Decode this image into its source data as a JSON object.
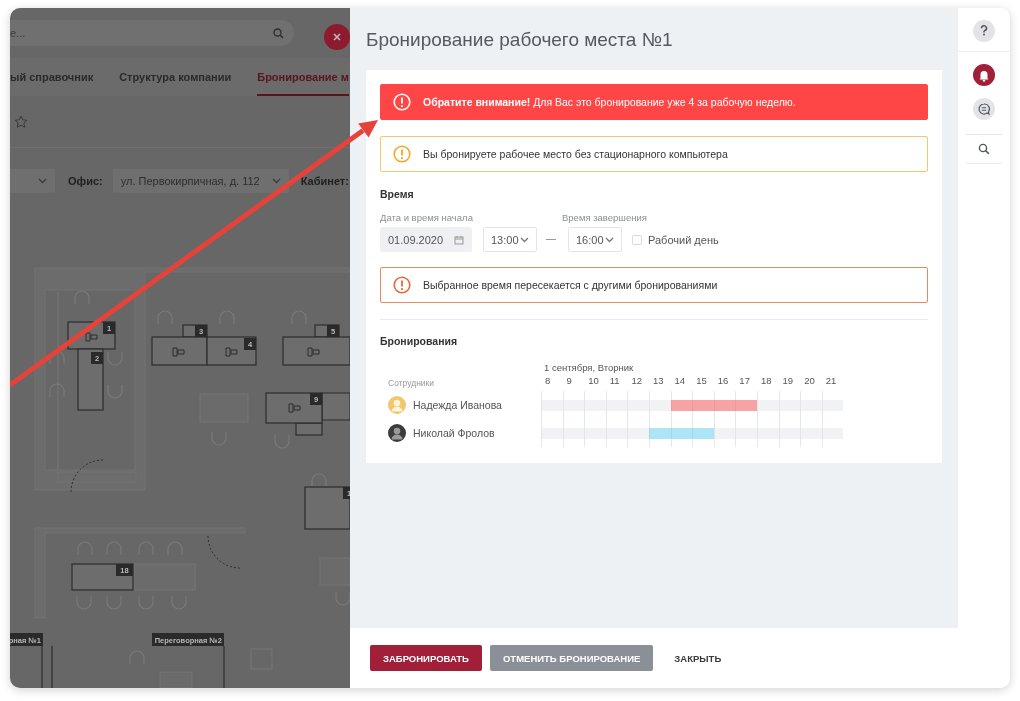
{
  "backdrop": {
    "search": {
      "placeholder": "е..."
    },
    "tabs": [
      {
        "label": "ый справочник",
        "selected": false
      },
      {
        "label": "Структура компании",
        "selected": false
      },
      {
        "label": "Бронирование м",
        "selected": true
      }
    ],
    "filters": {
      "office_label": "Офис:",
      "office_value": "ул. Первокирпичная, д. 112",
      "room_label": "Кабинет:"
    },
    "floor_plan": {
      "desks": [
        {
          "number": "1"
        },
        {
          "number": "2"
        },
        {
          "number": "3"
        },
        {
          "number": "4"
        },
        {
          "number": "5"
        },
        {
          "number": "9"
        },
        {
          "number": "1"
        },
        {
          "number": "18"
        }
      ],
      "rooms": [
        {
          "label": "рная №1"
        },
        {
          "label": "Переговорная №2"
        }
      ]
    }
  },
  "panel": {
    "title": "Бронирование рабочего места №1",
    "alerts": [
      {
        "kind": "error",
        "text": "**Обратите внимание!** Для Вас это бронирование уже 4 за рабочую неделю."
      },
      {
        "kind": "warning",
        "text": "Вы бронируете рабочее место без стационарного компьютера"
      }
    ],
    "time": {
      "heading": "Время",
      "start_label": "Дата и время начала",
      "date": "01.09.2020",
      "start_time": "13:00",
      "end_label": "Время завершения",
      "end_time": "16:00",
      "workday": {
        "label": "Рабочий день",
        "checked": false
      }
    },
    "conflict_alert": {
      "kind": "conflict",
      "text": "Выбранное время пересекается с другими бронированиями"
    },
    "bookings": {
      "heading": "Бронирования",
      "date": "1 сентября, Вторник",
      "employees_label": "Сотрудники",
      "hours": [
        "8",
        "9",
        "10",
        "11",
        "12",
        "13",
        "14",
        "15",
        "16",
        "17",
        "18",
        "19",
        "20",
        "21"
      ],
      "rows": [
        {
          "name": "Надежда Иванова",
          "color": "#f7a3a5",
          "slots": [
            {
              "booked": false
            },
            {
              "booked": false
            },
            {
              "booked": false
            },
            {
              "booked": false
            },
            {
              "booked": false
            },
            {
              "booked": false
            },
            {
              "booked": true
            },
            {
              "booked": true
            },
            {
              "booked": true
            },
            {
              "booked": true
            },
            {
              "booked": false
            },
            {
              "booked": false
            },
            {
              "booked": false
            },
            {
              "booked": false
            }
          ]
        },
        {
          "name": "Николай Фролов",
          "color": "#aee5f6",
          "slots": [
            {
              "booked": false
            },
            {
              "booked": false
            },
            {
              "booked": false
            },
            {
              "booked": false
            },
            {
              "booked": false
            },
            {
              "booked": true
            },
            {
              "booked": true
            },
            {
              "booked": true
            },
            {
              "booked": false
            },
            {
              "booked": false
            },
            {
              "booked": false
            },
            {
              "booked": false
            },
            {
              "booked": false
            },
            {
              "booked": false
            }
          ]
        }
      ]
    }
  },
  "footer": {
    "buttons": [
      {
        "label": "ЗАБРОНИРОВАТЬ",
        "kind": "primary"
      },
      {
        "label": "ОТМЕНИТЬ БРОНИРОВАНИЕ",
        "kind": "secondary"
      },
      {
        "label": "ЗАКРЫТЬ",
        "kind": "link"
      }
    ]
  },
  "rail": [
    {
      "kind": "help",
      "selected": false
    },
    {
      "kind": "bell",
      "selected": true
    },
    {
      "kind": "chat",
      "selected": false
    },
    {
      "kind": "search",
      "selected": false
    }
  ]
}
